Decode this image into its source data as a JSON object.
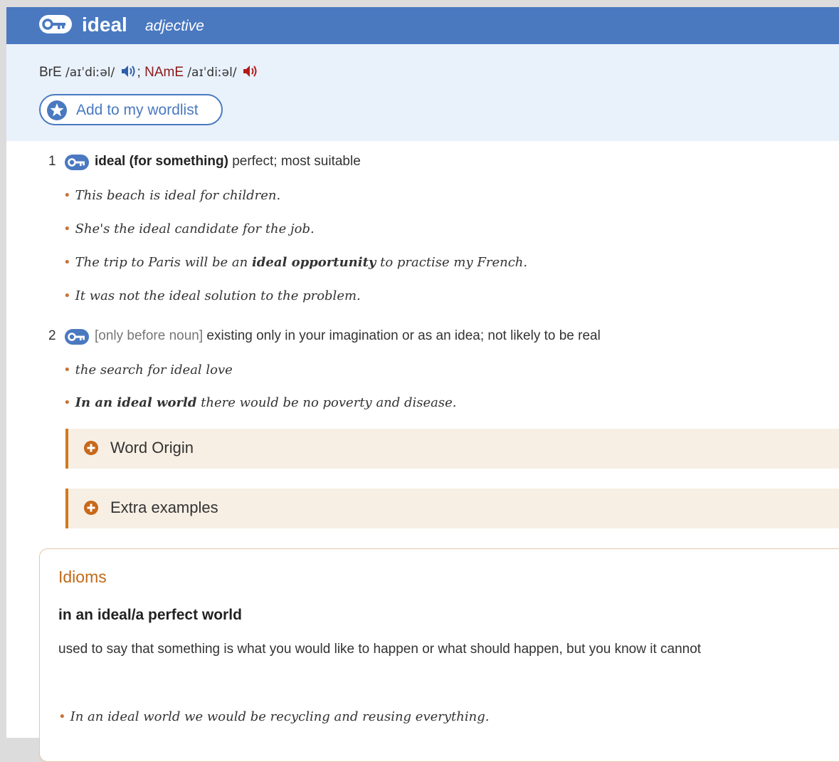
{
  "entry": {
    "headword": "ideal",
    "part_of_speech": "adjective",
    "pronunciation": {
      "bre_label": "BrE",
      "bre_ipa": "/aɪˈdiːəl/",
      "separator": ";",
      "name_label": "NAmE",
      "name_ipa": "/aɪˈdiːəl/"
    },
    "wordlist_button": "Add to my wordlist"
  },
  "senses": [
    {
      "num": "1",
      "grammar": "",
      "headword_pattern": "ideal (for something)",
      "definition": "perfect; most suitable",
      "examples": [
        {
          "text": "This beach is ideal for children."
        },
        {
          "text": "She's the ideal candidate for the job."
        },
        {
          "pre": "The trip to Paris will be an ",
          "bold": "ideal opportunity",
          "post": " to practise my French."
        },
        {
          "text": "It was not the ideal solution to the problem."
        }
      ]
    },
    {
      "num": "2",
      "grammar": "[only before noun]",
      "headword_pattern": "",
      "definition": "existing only in your imagination or as an idea; not likely to be real",
      "examples": [
        {
          "text": "the search for ideal love"
        },
        {
          "bold": "In an ideal world",
          "post": " there would be no poverty and disease."
        }
      ]
    }
  ],
  "collapsibles": [
    "Word Origin",
    "Extra examples"
  ],
  "idioms": {
    "title": "Idioms",
    "phrase": "in an ideal/a perfect world",
    "definition": "used to say that something is what you would like to happen or what should happen, but you know it cannot",
    "example": "In an ideal world we would be recycling and reusing everything."
  },
  "colors": {
    "header_blue": "#4a79c0",
    "band_light_blue": "#e9f1fb",
    "accent_orange": "#d07a1f",
    "name_red": "#8b1a1a",
    "collapse_bg": "#f7efe4"
  },
  "icons": {
    "headword_key": "key-icon",
    "speaker_bre": "speaker-icon-blue",
    "speaker_name": "speaker-icon-red",
    "wordlist_star": "star-icon",
    "expand": "plus-circle-icon"
  }
}
